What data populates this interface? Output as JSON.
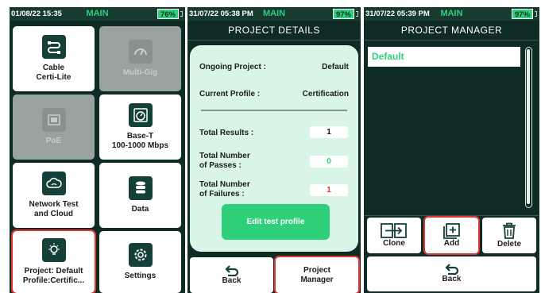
{
  "screen_main": {
    "status": {
      "time": "01/08/22 15:35",
      "mode": "MAIN",
      "battery": "76%"
    },
    "tiles": [
      {
        "label_line1": "Cable",
        "label_line2": "Certi-Lite",
        "icon": "cable-icon"
      },
      {
        "label_line1": "Multi-Gig",
        "label_line2": "",
        "icon": "speedometer-icon"
      },
      {
        "label_line1": "PoE",
        "label_line2": "",
        "icon": "ethernet-port-icon"
      },
      {
        "label_line1": "Base-T",
        "label_line2": "100-1000 Mbps",
        "icon": "timer-icon"
      },
      {
        "label_line1": "Network Test",
        "label_line2": "and Cloud",
        "icon": "cloud-icon"
      },
      {
        "label_line1": "Data",
        "label_line2": "",
        "icon": "database-icon"
      },
      {
        "label_line1": "Project: Default",
        "label_line2": "Profile:Certific...",
        "icon": "lightbulb-icon"
      },
      {
        "label_line1": "Settings",
        "label_line2": "",
        "icon": "gear-icon"
      }
    ]
  },
  "screen_project_details": {
    "status": {
      "time": "31/07/22 05:38 PM",
      "mode": "MAIN",
      "battery": "97%"
    },
    "title": "PROJECT DETAILS",
    "ongoing_project_label": "Ongoing Project :",
    "ongoing_project_value": "Default",
    "current_profile_label": "Current Profile :",
    "current_profile_value": "Certification",
    "total_results_label": "Total Results :",
    "total_results_value": "1",
    "passes_label_line1": "Total Number",
    "passes_label_line2": "of Passes :",
    "passes_value": "0",
    "failures_label_line1": "Total Number",
    "failures_label_line2": "of Failures :",
    "failures_value": "1",
    "edit_button": "Edit test profile",
    "back_button": "Back",
    "manager_button_line1": "Project",
    "manager_button_line2": "Manager",
    "colors": {
      "pass": "#2fd07a",
      "fail": "#e3342f"
    }
  },
  "screen_project_manager": {
    "status": {
      "time": "31/07/22 05:39 PM",
      "mode": "MAIN",
      "battery": "97%"
    },
    "title": "PROJECT MANAGER",
    "projects": [
      "Default"
    ],
    "clone_button": "Clone",
    "add_button": "Add",
    "delete_button": "Delete",
    "back_button": "Back"
  },
  "colors": {
    "accent": "#2fd07a",
    "background": "#0f2b25",
    "highlight": "#e3342f"
  }
}
